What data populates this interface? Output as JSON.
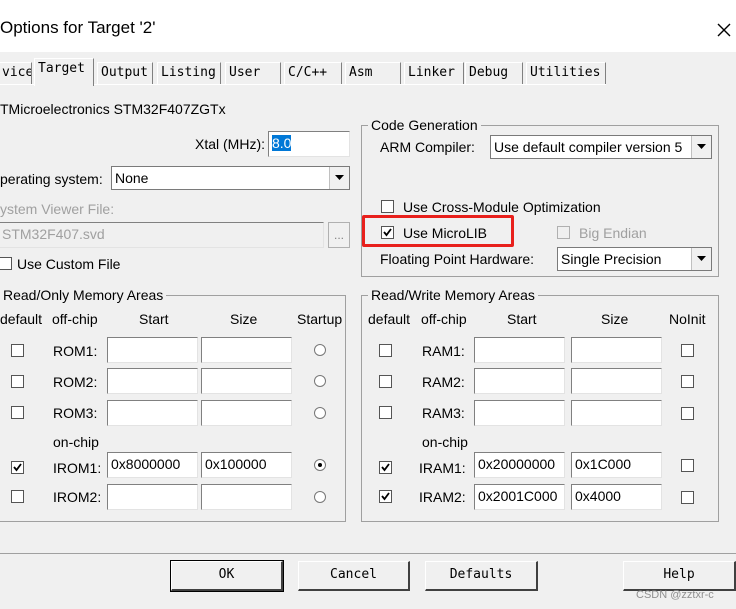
{
  "window": {
    "title": "Options for Target '2'"
  },
  "tabs": [
    {
      "label": "vice"
    },
    {
      "label": "Target"
    },
    {
      "label": "Output"
    },
    {
      "label": "Listing"
    },
    {
      "label": "User"
    },
    {
      "label": "C/C++"
    },
    {
      "label": "Asm"
    },
    {
      "label": "Linker"
    },
    {
      "label": "Debug"
    },
    {
      "label": "Utilities"
    }
  ],
  "device": {
    "name": "TMicroelectronics STM32F407ZGTx",
    "xtal_label": "Xtal (MHz):",
    "xtal_value": "8.0",
    "os_label": "perating system:",
    "os_value": "None",
    "svd_label": "ystem Viewer File:",
    "svd_value": "STM32F407.svd",
    "browse_label": "...",
    "custom_file_label": "Use Custom File",
    "custom_file_checked": false
  },
  "code_generation": {
    "title": "Code Generation",
    "arm_compiler_label": "ARM Compiler:",
    "arm_compiler_value": "Use default compiler version 5",
    "cross_module_label": "Use Cross-Module Optimization",
    "cross_module_checked": false,
    "microlib_label": "Use MicroLIB",
    "microlib_checked": true,
    "big_endian_label": "Big Endian",
    "big_endian_checked": false,
    "fpu_label": "Floating Point Hardware:",
    "fpu_value": "Single Precision"
  },
  "ro_memory": {
    "title": "Read/Only Memory Areas",
    "headers": [
      "default",
      "off-chip",
      "Start",
      "Size",
      "Startup"
    ],
    "onchip_label": "on-chip",
    "rows": [
      {
        "name": "ROM1:",
        "start": "",
        "size": "",
        "default": false,
        "startup": false
      },
      {
        "name": "ROM2:",
        "start": "",
        "size": "",
        "default": false,
        "startup": false
      },
      {
        "name": "ROM3:",
        "start": "",
        "size": "",
        "default": false,
        "startup": false
      },
      {
        "name": "IROM1:",
        "start": "0x8000000",
        "size": "0x100000",
        "default": true,
        "startup": true
      },
      {
        "name": "IROM2:",
        "start": "",
        "size": "",
        "default": false,
        "startup": false
      }
    ]
  },
  "rw_memory": {
    "title": "Read/Write Memory Areas",
    "headers": [
      "default",
      "off-chip",
      "Start",
      "Size",
      "NoInit"
    ],
    "onchip_label": "on-chip",
    "rows": [
      {
        "name": "RAM1:",
        "start": "",
        "size": "",
        "default": false,
        "noinit": false
      },
      {
        "name": "RAM2:",
        "start": "",
        "size": "",
        "default": false,
        "noinit": false
      },
      {
        "name": "RAM3:",
        "start": "",
        "size": "",
        "default": false,
        "noinit": false
      },
      {
        "name": "IRAM1:",
        "start": "0x20000000",
        "size": "0x1C000",
        "default": true,
        "noinit": false
      },
      {
        "name": "IRAM2:",
        "start": "0x2001C000",
        "size": "0x4000",
        "default": true,
        "noinit": false
      }
    ]
  },
  "buttons": {
    "ok": "OK",
    "cancel": "Cancel",
    "defaults": "Defaults",
    "help": "Help"
  },
  "watermark": "CSDN @zztxr-c",
  "colors": {
    "highlight": "#e8201c",
    "selection": "#0078d7"
  }
}
